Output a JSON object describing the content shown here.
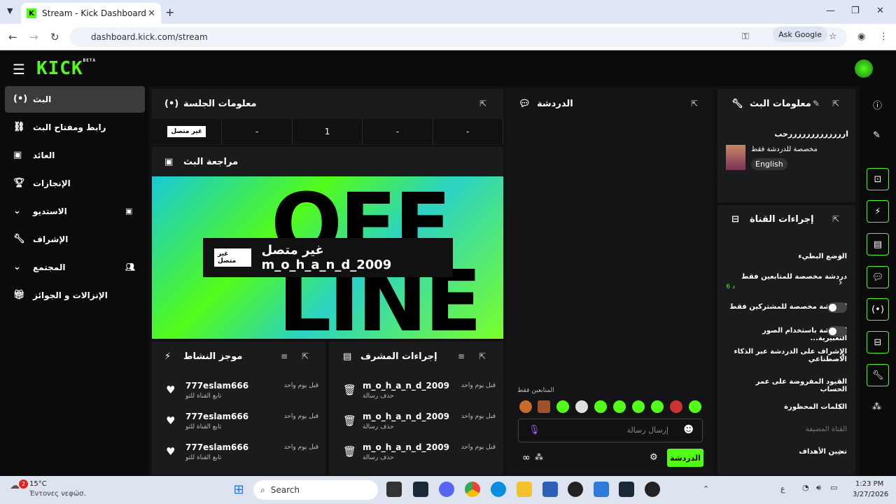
{
  "browser": {
    "tab_title": "Stream - Kick Dashboard",
    "url": "dashboard.kick.com/stream",
    "ask_google": "Ask Google",
    "new_tab": "+",
    "tab_close": "✕"
  },
  "app": {
    "logo": "KICK",
    "logo_sup": "BETA"
  },
  "sidebar": {
    "items": [
      {
        "label": "البث",
        "icon": "broadcast-icon"
      },
      {
        "label": "رابط ومفتاح البث",
        "icon": "link-icon"
      },
      {
        "label": "العائد",
        "icon": "revenue-icon"
      },
      {
        "label": "الإنجازات",
        "icon": "trophy-icon"
      },
      {
        "label": "الاستديو",
        "icon": "studio-icon"
      },
      {
        "label": "الإشراف",
        "icon": "wrench-icon"
      },
      {
        "label": "المجتمع",
        "icon": "community-icon"
      },
      {
        "label": "الإنزالات و الجوائز",
        "icon": "gift-icon"
      }
    ]
  },
  "session": {
    "title": "معلومات الجلسة",
    "status": "غير متصل",
    "cells": [
      "-",
      "1",
      "-",
      "-"
    ]
  },
  "preview": {
    "title": "مراجعة البث",
    "offline_label": "غير متصل",
    "offline_text": "غير متصل m_o_h_a_n_d_2009",
    "big_text_1": "OFF",
    "big_text_2": "LINE"
  },
  "activity": {
    "title": "موجز النشاط",
    "rows": [
      {
        "name": "777eslam666",
        "sub": "تابع القناة للتو",
        "time": "قبل يوم واحد"
      },
      {
        "name": "777eslam666",
        "sub": "تابع القناة للتو",
        "time": "قبل يوم واحد"
      },
      {
        "name": "777eslam666",
        "sub": "تابع القناة للتو",
        "time": "قبل يوم واحد"
      }
    ]
  },
  "modactions": {
    "title": "إجراءات المشرف",
    "rows": [
      {
        "name": "m_o_h_a_n_d_2009",
        "sub": "حذف رسالة",
        "time": "قبل يوم واحد"
      },
      {
        "name": "m_o_h_a_n_d_2009",
        "sub": "حذف رسالة",
        "time": "قبل يوم واحد"
      },
      {
        "name": "m_o_h_a_n_d_2009",
        "sub": "حذف رسالة",
        "time": "قبل يوم واحد"
      }
    ]
  },
  "chat": {
    "title": "الدردشة",
    "followers_only": "المتابعين فقط",
    "input_placeholder": "إرسال رسالة",
    "send_label": "الدردشة"
  },
  "stream_info": {
    "title": "معلومات البث",
    "stream_title": "ارررررررررررررحب",
    "category": "مخصصة للدردشة فقط",
    "language": "English"
  },
  "channel_actions": {
    "title": "إجراءات القناة",
    "rows": [
      {
        "label": "الوضع البطيء"
      },
      {
        "label": "دردشة مخصصة للمتابعين فقط",
        "sub": "6 د"
      },
      {
        "label": "الدردشة مخصصة للمشتركين فقط"
      },
      {
        "label": "الدردشة باستخدام الصور التعبيرية..."
      },
      {
        "label": "الإشراف على الدردشة عبر الذكاء الاصطناعي"
      },
      {
        "label": "القيود المفروضة على عمر الحساب"
      },
      {
        "label": "الكلمات المحظورة"
      },
      {
        "label": "القناة المضيفة"
      },
      {
        "label": "تعيين الأهداف"
      }
    ]
  },
  "taskbar": {
    "weather": "15°C",
    "weather_desc": "Έντονες νεφώσ.",
    "search": "Search",
    "time": "1:23 PM",
    "date": "3/27/2026",
    "badge": "2",
    "lang": "ع"
  },
  "colors": {
    "accent": "#53fc18",
    "bg": "#111111",
    "panel": "#1a1b1d"
  }
}
